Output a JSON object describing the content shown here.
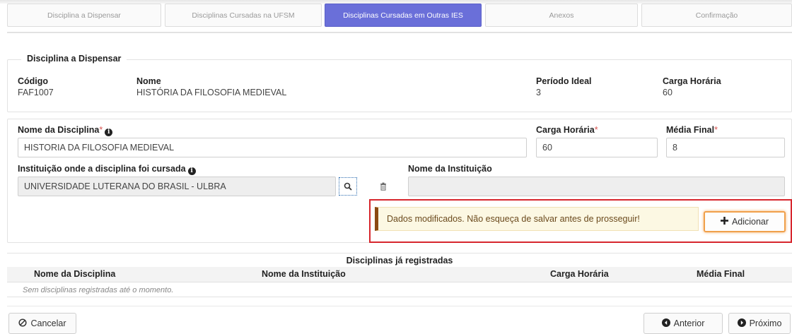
{
  "steps": [
    {
      "label": "Disciplina a Dispensar",
      "active": false
    },
    {
      "label": "Disciplinas Cursadas na UFSM",
      "active": false
    },
    {
      "label": "Disciplinas Cursadas em Outras IES",
      "active": true
    },
    {
      "label": "Anexos",
      "active": false
    },
    {
      "label": "Confirmação",
      "active": false
    }
  ],
  "dispensar": {
    "legend": "Disciplina a Dispensar",
    "codigo_label": "Código",
    "codigo_value": "FAF1007",
    "nome_label": "Nome",
    "nome_value": "HISTÓRIA DA FILOSOFIA MEDIEVAL",
    "periodo_label": "Período Ideal",
    "periodo_value": "3",
    "carga_label": "Carga Horária",
    "carga_value": "60"
  },
  "form": {
    "nome_disciplina_label": "Nome da Disciplina",
    "nome_disciplina_value": "HISTORIA DA FILOSOFIA MEDIEVAL",
    "carga_label": "Carga Horária",
    "carga_value": "60",
    "media_label": "Média Final",
    "media_value": "8",
    "instituicao_label": "Instituição onde a disciplina foi cursada",
    "instituicao_value": "UNIVERSIDADE LUTERANA DO BRASIL - ULBRA",
    "nome_instituicao_label": "Nome da Instituição",
    "nome_instituicao_value": "",
    "required_mark": "*",
    "info_glyph": "i"
  },
  "alert": {
    "text": "Dados modificados. Não esqueça de salvar antes de prosseguir!"
  },
  "buttons": {
    "adicionar": "Adicionar",
    "cancelar": "Cancelar",
    "anterior": "Anterior",
    "proximo": "Próximo"
  },
  "registradas": {
    "title": "Disciplinas já registradas",
    "columns": [
      "Nome da Disciplina",
      "Nome da Instituição",
      "Carga Horária",
      "Média Final"
    ],
    "empty_message": "Sem disciplinas registradas até o momento."
  },
  "colors": {
    "active_step": "#6a6fd9",
    "highlight_border": "#d7262d",
    "alert_bg": "#fcf8e3",
    "add_button_glow": "#f0a04b"
  }
}
